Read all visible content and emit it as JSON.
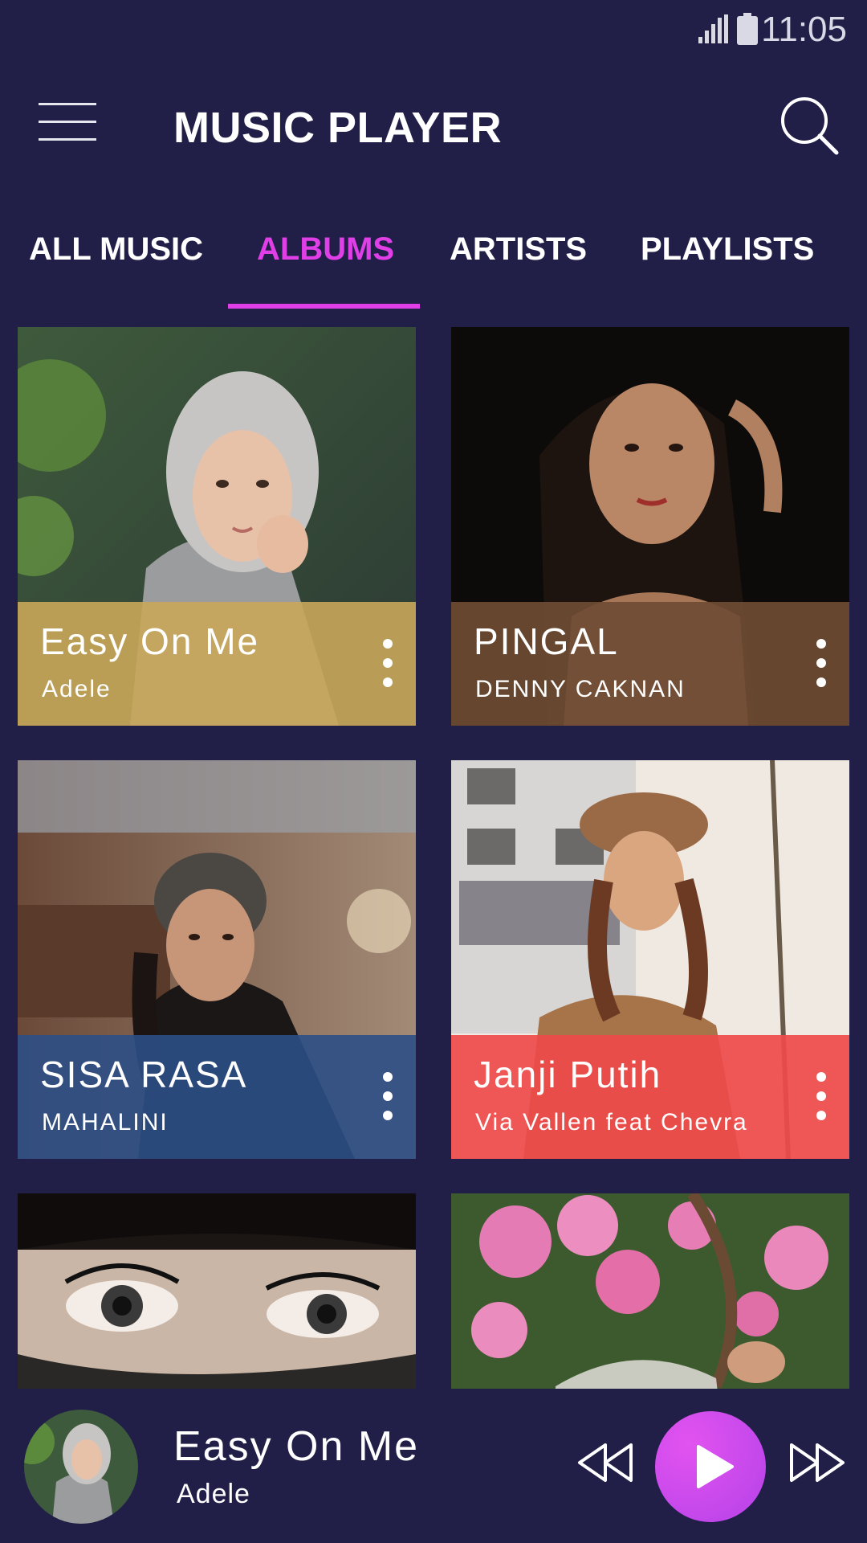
{
  "status_bar": {
    "time": "11:05",
    "icons": [
      "signal-icon",
      "battery-icon"
    ]
  },
  "header": {
    "title": "MUSIC PLAYER",
    "left_icon": "menu-icon",
    "right_icon": "search-icon"
  },
  "tabs": [
    {
      "label": "ALL MUSIC",
      "active": false
    },
    {
      "label": "ALBUMS",
      "active": true
    },
    {
      "label": "ARTISTS",
      "active": false
    },
    {
      "label": "PLAYLISTS",
      "active": false
    }
  ],
  "albums": [
    {
      "title": "Easy On Me",
      "artist": "Adele",
      "overlay_color": "#c9a75a"
    },
    {
      "title": "PINGAL",
      "artist": "DENNY CAKNAN",
      "overlay_color": "#6e4c33"
    },
    {
      "title": "SISA RASA",
      "artist": "MAHALINI",
      "overlay_color": "#2c4f86"
    },
    {
      "title": "Janji Putih",
      "artist": "Via Vallen feat Chevra",
      "overlay_color": "#ef4a4a"
    }
  ],
  "now_playing": {
    "title": "Easy On Me",
    "artist": "Adele",
    "controls": [
      "rewind-icon",
      "play-icon",
      "fast-forward-icon"
    ]
  },
  "colors": {
    "background": "#211f48",
    "accent": "#e03ee6",
    "play_button": "#c94ae9"
  }
}
